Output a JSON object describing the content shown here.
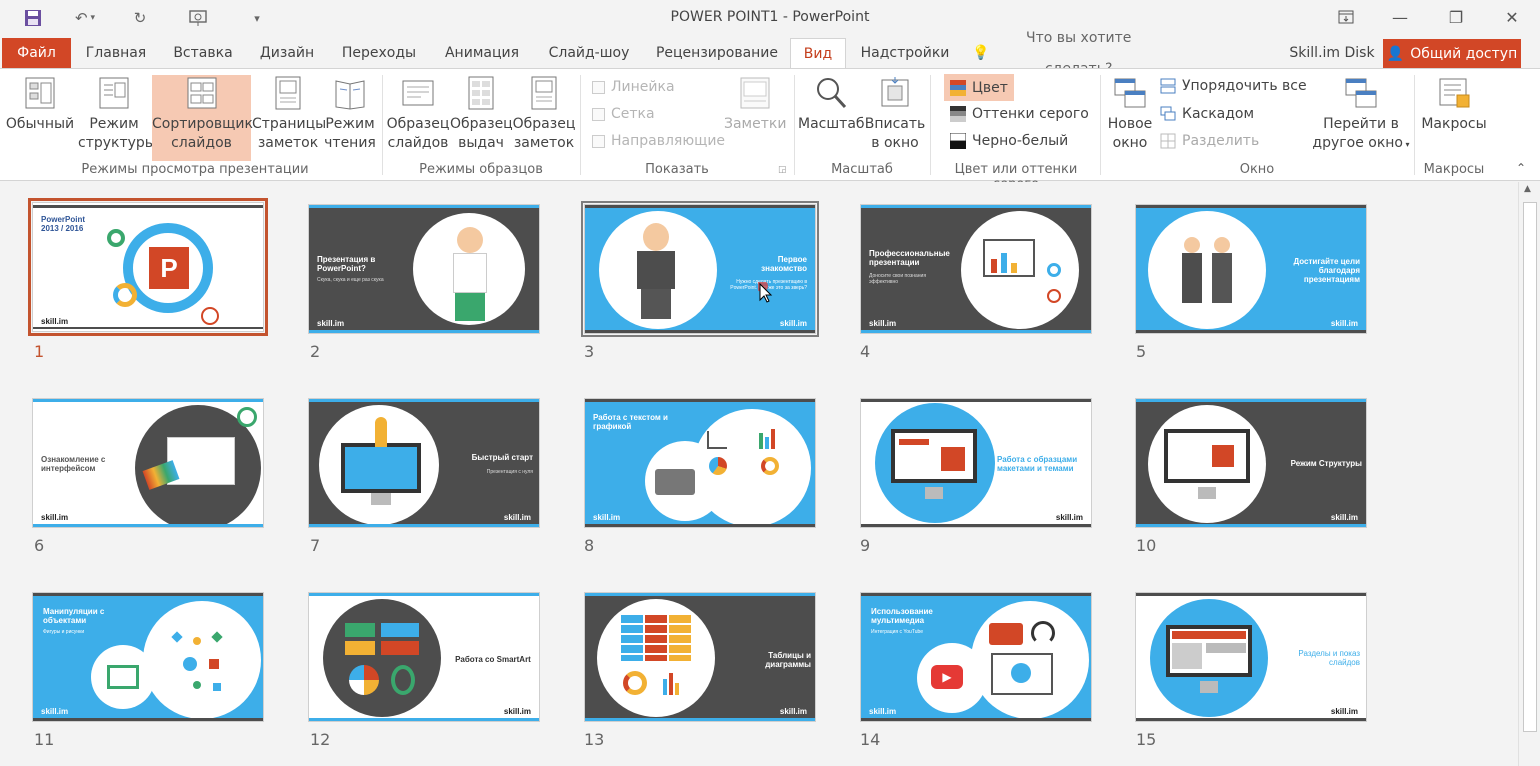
{
  "window": {
    "title": "POWER POINT1 - PowerPoint"
  },
  "tabs": [
    "Файл",
    "Главная",
    "Вставка",
    "Дизайн",
    "Переходы",
    "Анимация",
    "Слайд-шоу",
    "Рецензирование",
    "Вид",
    "Надстройки"
  ],
  "tell_me": "Что вы хотите сделать?",
  "account": "Skill.im Disk",
  "share": "Общий доступ",
  "ribbon": {
    "views": [
      {
        "l1": "Обычный",
        "l2": ""
      },
      {
        "l1": "Режим",
        "l2": "структуры"
      },
      {
        "l1": "Сортировщик",
        "l2": "слайдов"
      },
      {
        "l1": "Страницы",
        "l2": "заметок"
      },
      {
        "l1": "Режим",
        "l2": "чтения"
      }
    ],
    "views_group": "Режимы просмотра презентации",
    "masters": [
      {
        "l1": "Образец",
        "l2": "слайдов"
      },
      {
        "l1": "Образец",
        "l2": "выдач"
      },
      {
        "l1": "Образец",
        "l2": "заметок"
      }
    ],
    "masters_group": "Режимы образцов",
    "show": [
      "Линейка",
      "Сетка",
      "Направляющие"
    ],
    "notes": "Заметки",
    "show_group": "Показать",
    "zoom": "Масштаб",
    "fit": {
      "l1": "Вписать",
      "l2": "в окно"
    },
    "zoom_group": "Масштаб",
    "color": [
      "Цвет",
      "Оттенки серого",
      "Черно-белый"
    ],
    "color_group": "Цвет или оттенки серого",
    "new_window": {
      "l1": "Новое",
      "l2": "окно"
    },
    "window_cmds": [
      "Упорядочить все",
      "Каскадом",
      "Разделить"
    ],
    "switch": {
      "l1": "Перейти в",
      "l2": "другое окно"
    },
    "window_group": "Окно",
    "macros": "Макросы",
    "macros_group": "Макросы"
  },
  "slides": [
    {
      "num": "1",
      "title": "PowerPoint 2013 / 2016",
      "sub": "",
      "logo": "skill.im"
    },
    {
      "num": "2",
      "title": "Презентация в PowerPoint?",
      "sub": "Скука, скука и еще раз скука",
      "logo": "skill.im"
    },
    {
      "num": "3",
      "title": "Первое знакомство",
      "sub": "Нужно сделать презентацию в PowerPoint. Что же это за зверь?",
      "logo": "skill.im"
    },
    {
      "num": "4",
      "title": "Профессиональные презентации",
      "sub": "Доносите свои познания эффективно",
      "logo": "skill.im"
    },
    {
      "num": "5",
      "title": "Достигайте цели благодаря презентациям",
      "sub": "",
      "logo": "skill.im"
    },
    {
      "num": "6",
      "title": "Ознакомление с интерфейсом",
      "sub": "",
      "logo": "skill.im"
    },
    {
      "num": "7",
      "title": "Быстрый старт",
      "sub": "Презентация с нуля",
      "logo": "skill.im"
    },
    {
      "num": "8",
      "title": "Работа с текстом и графикой",
      "sub": "",
      "logo": "skill.im"
    },
    {
      "num": "9",
      "title": "Работа с образцами макетами и темами",
      "sub": "",
      "logo": "skill.im"
    },
    {
      "num": "10",
      "title": "Режим Структуры",
      "sub": "",
      "logo": "skill.im"
    },
    {
      "num": "11",
      "title": "Манипуляции с объектами",
      "sub": "Фигуры и рисунки",
      "logo": "skill.im"
    },
    {
      "num": "12",
      "title": "Работа со SmartArt",
      "sub": "",
      "logo": "skill.im"
    },
    {
      "num": "13",
      "title": "Таблицы и диаграммы",
      "sub": "",
      "logo": "skill.im"
    },
    {
      "num": "14",
      "title": "Использование мультимедиа",
      "sub": "Интеграция с YouTube",
      "logo": "skill.im"
    },
    {
      "num": "15",
      "title": "Разделы и показ слайдов",
      "sub": "",
      "logo": "skill.im"
    }
  ],
  "colors": {
    "accent": "#d24726",
    "blue": "#3daee9",
    "dark": "#4d4d4d",
    "white": "#ffffff"
  }
}
